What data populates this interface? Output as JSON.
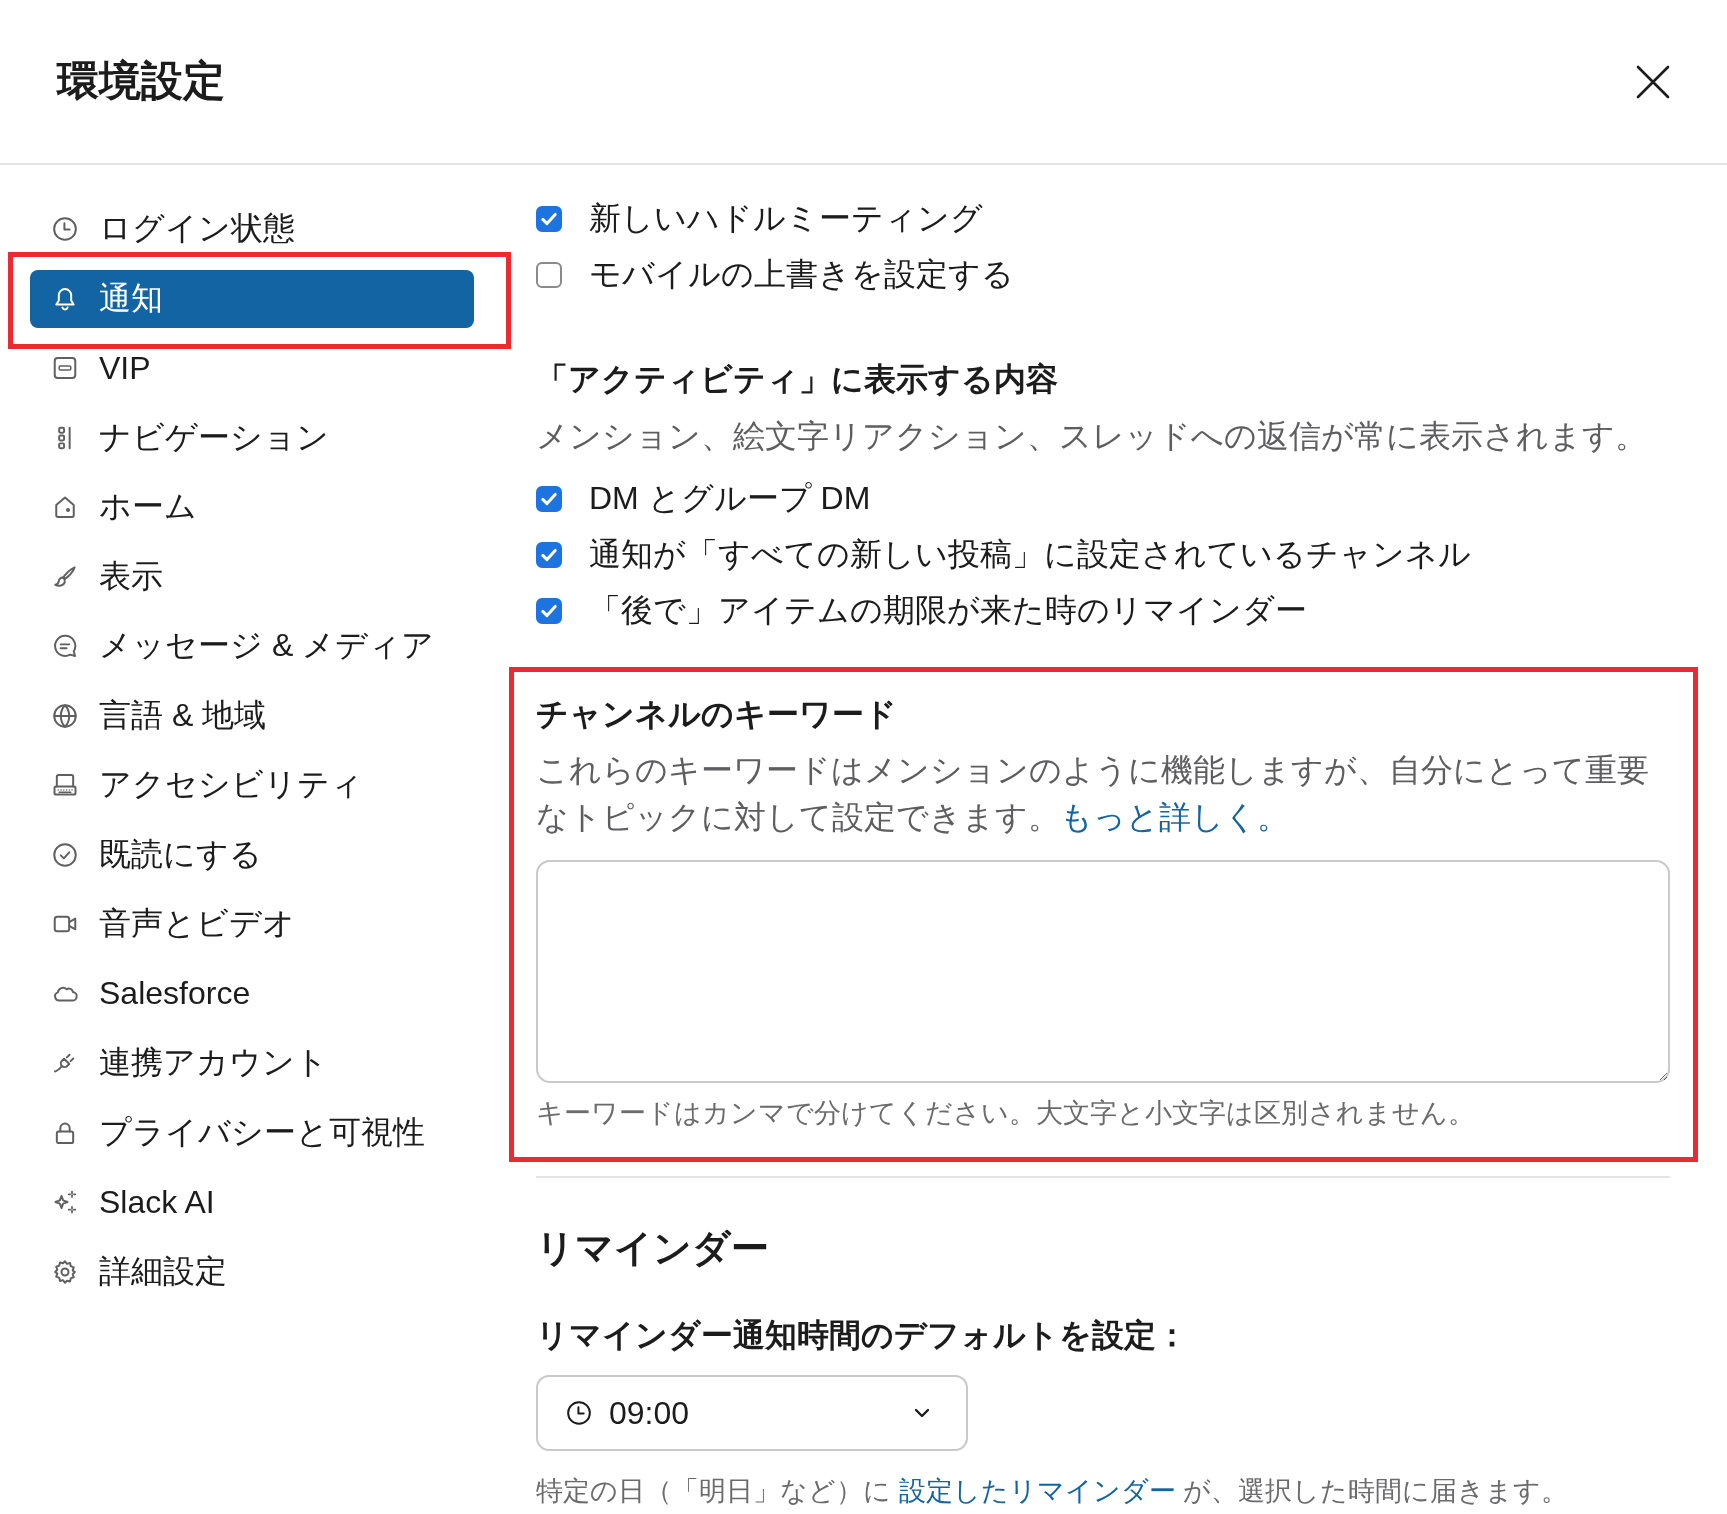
{
  "window": {
    "title": "環境設定"
  },
  "sidebar": {
    "items": [
      {
        "label": "ログイン状態",
        "selected": false,
        "highlighted": false
      },
      {
        "label": "通知",
        "selected": true,
        "highlighted": true
      },
      {
        "label": "VIP",
        "selected": false,
        "highlighted": false
      },
      {
        "label": "ナビゲーション",
        "selected": false,
        "highlighted": false
      },
      {
        "label": "ホーム",
        "selected": false,
        "highlighted": false
      },
      {
        "label": "表示",
        "selected": false,
        "highlighted": false
      },
      {
        "label": "メッセージ & メディア",
        "selected": false,
        "highlighted": false
      },
      {
        "label": "言語 & 地域",
        "selected": false,
        "highlighted": false
      },
      {
        "label": "アクセシビリティ",
        "selected": false,
        "highlighted": false
      },
      {
        "label": "既読にする",
        "selected": false,
        "highlighted": false
      },
      {
        "label": "音声とビデオ",
        "selected": false,
        "highlighted": false
      },
      {
        "label": "Salesforce",
        "selected": false,
        "highlighted": false
      },
      {
        "label": "連携アカウント",
        "selected": false,
        "highlighted": false
      },
      {
        "label": "プライバシーと可視性",
        "selected": false,
        "highlighted": false
      },
      {
        "label": "Slack AI",
        "selected": false,
        "highlighted": false
      },
      {
        "label": "詳細設定",
        "selected": false,
        "highlighted": false
      }
    ]
  },
  "notifications": {
    "options": [
      {
        "label": "新しいハドルミーティング",
        "checked": true
      },
      {
        "label": "モバイルの上書きを設定する",
        "checked": false
      }
    ]
  },
  "activity": {
    "title": "「アクティビティ」に表示する内容",
    "description": "メンション、絵文字リアクション、スレッドへの返信が常に表示されます。",
    "options": [
      {
        "label": "DM とグループ DM",
        "checked": true
      },
      {
        "label": "通知が「すべての新しい投稿」に設定されているチャンネル",
        "checked": true
      },
      {
        "label": "「後で」アイテムの期限が来た時のリマインダー",
        "checked": true
      }
    ]
  },
  "channel_keywords": {
    "title": "チャンネルのキーワード",
    "description": "これらのキーワードはメンションのように機能しますが、自分にとって重要なトピックに対して設定できます。",
    "link": "もっと詳しく。",
    "hint": "キーワードはカンマで分けてください。大文字と小文字は区別されません。",
    "highlighted": true
  },
  "reminders": {
    "title": "リマインダー",
    "label": "リマインダー通知時間のデフォルトを設定：",
    "time": "09:00",
    "note_before": "特定の日（「明日」など）に ",
    "note_link": "設定したリマインダー",
    "note_after": " が、選択した時間に届きます。"
  }
}
